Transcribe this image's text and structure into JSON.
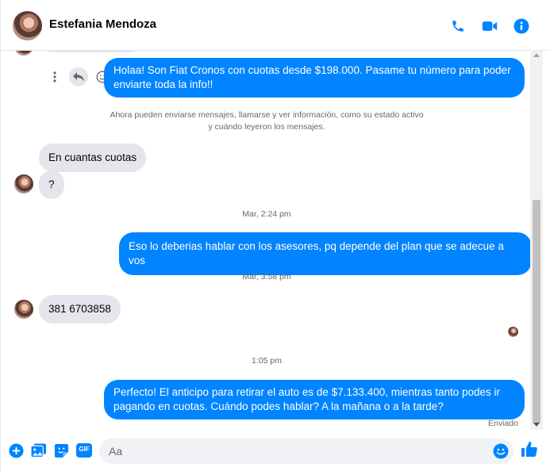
{
  "header": {
    "contact_name": "Estefania Mendoza",
    "icons": [
      "phone-icon",
      "video-call-icon",
      "info-icon"
    ],
    "accent_color": "#0084ff"
  },
  "messages": [
    {
      "id": "m1",
      "side": "out",
      "text": "Holaa! Son Fiat Cronos con cuotas desde $198.000. Pasame tu número para poder enviarte toda la info!!"
    },
    {
      "id": "sys",
      "text_line1": "Ahora pueden enviarse mensajes, llamarse y ver información, como su estado activo",
      "text_line2": "y cuándo leyeron los mensajes."
    },
    {
      "id": "m2",
      "side": "in",
      "text": "En cuantas cuotas"
    },
    {
      "id": "m3",
      "side": "in",
      "text": "?"
    },
    {
      "id": "ts1",
      "text": "Mar, 2:24 pm"
    },
    {
      "id": "m4",
      "side": "out",
      "text": "Eso lo deberias hablar con los asesores, pq depende del  plan que se adecue a vos"
    },
    {
      "id": "ts2",
      "text": "Mar, 3:58 pm"
    },
    {
      "id": "m5",
      "side": "in",
      "text": "381 6703858"
    },
    {
      "id": "ts3",
      "text": "1:05 pm"
    },
    {
      "id": "m6",
      "side": "out",
      "text": "Perfecto! El anticipo para retirar el auto es de $7.133.400, mientras tanto podes ir pagando en cuotas. Cuándo podes hablar? A la mañana o a la tarde?"
    }
  ],
  "sent_status": "Enviado",
  "composer": {
    "placeholder": "Aa",
    "icons": [
      "add-icon",
      "photo-icon",
      "sticker-icon",
      "gif-icon",
      "emoji-icon",
      "like-icon"
    ],
    "gif_label": "GIF"
  }
}
